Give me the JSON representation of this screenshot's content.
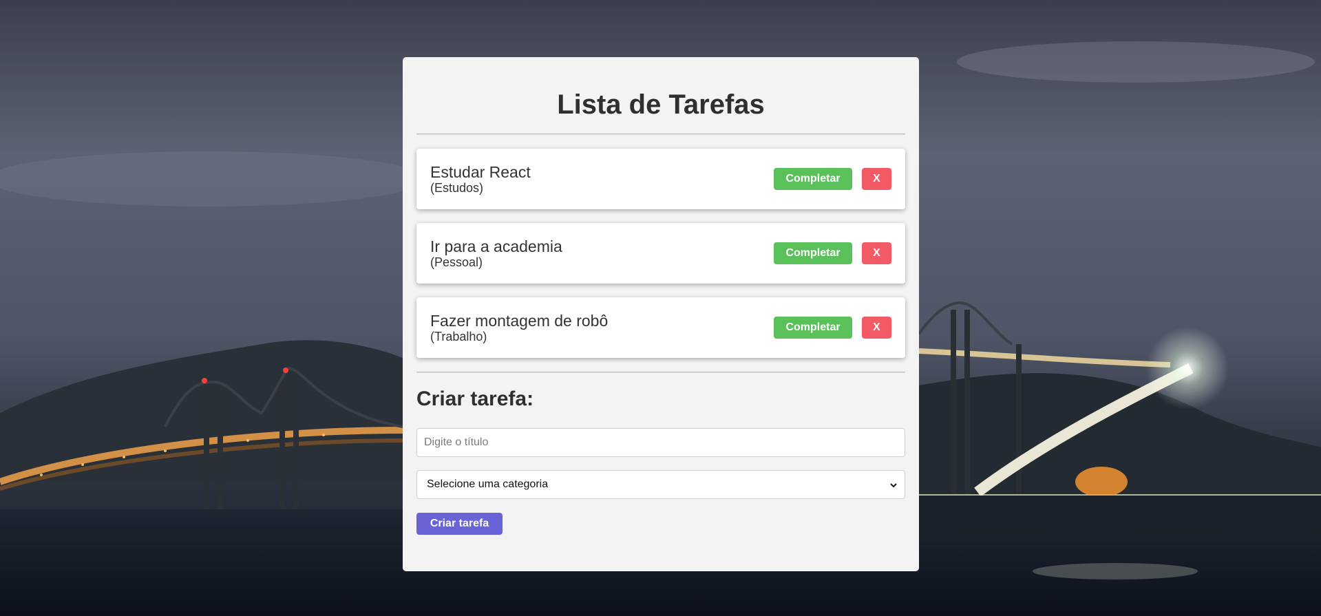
{
  "header": {
    "title": "Lista de Tarefas"
  },
  "todos": [
    {
      "title": "Estudar React",
      "category": "(Estudos)"
    },
    {
      "title": "Ir para a academia",
      "category": "(Pessoal)"
    },
    {
      "title": "Fazer montagem de robô",
      "category": "(Trabalho)"
    }
  ],
  "actions": {
    "complete_label": "Completar",
    "remove_label": "X"
  },
  "form": {
    "title": "Criar tarefa:",
    "title_placeholder": "Digite o título",
    "title_value": "",
    "category_selected": "Selecione uma categoria",
    "submit_label": "Criar tarefa"
  },
  "colors": {
    "complete": "#5ac15a",
    "remove": "#f25a66",
    "submit": "#6a63d8",
    "card": "#f3f3f3"
  },
  "icons": {
    "select_arrow": "chevron-down-icon"
  }
}
